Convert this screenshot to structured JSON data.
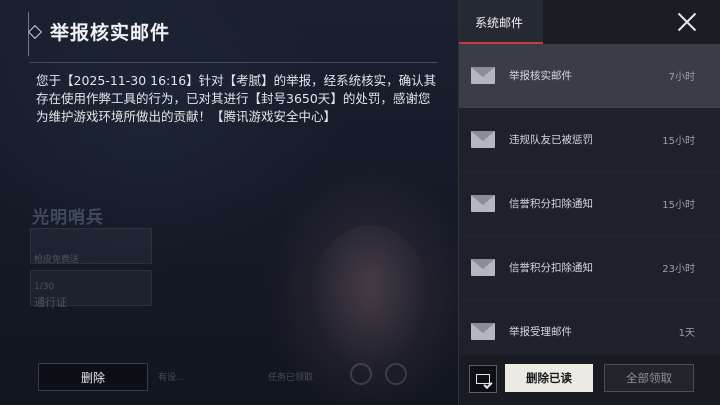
{
  "background": {
    "title_text": "光明哨兵",
    "card1_text": "枪皮免费送",
    "card2_text_a": "1/30",
    "card2_text_b": "通行证",
    "bottom_left_text": "有设...",
    "bottom_mid_text": "任务已领取"
  },
  "detail": {
    "title": "举报核实邮件",
    "body": "您于【2025-11-30 16:16】针对【考腻】的举报，经系统核实，确认其存在使用作弊工具的行为，已对其进行【封号3650天】的处罚，感谢您为维护游戏环境所做出的贡献！【腾讯游戏安全中心】",
    "delete_label": "删除"
  },
  "panel": {
    "tab_label": "系统邮件",
    "mails": [
      {
        "subject": "举报核实邮件",
        "time": "7小时",
        "active": true
      },
      {
        "subject": "违规队友已被惩罚",
        "time": "15小时",
        "active": false
      },
      {
        "subject": "信誉积分扣除通知",
        "time": "15小时",
        "active": false
      },
      {
        "subject": "信誉积分扣除通知",
        "time": "23小时",
        "active": false
      },
      {
        "subject": "举报受理邮件",
        "time": "1天",
        "active": false
      }
    ],
    "delete_read_label": "删除已读",
    "collect_all_label": "全部领取"
  },
  "colors": {
    "accent_red": "#c83a3e",
    "active_item_bg": "#3a3d45",
    "primary_button_bg": "#eceae3"
  },
  "icons": {
    "mail": "envelope-icon",
    "close": "close-icon",
    "mark_read": "envelope-check-icon",
    "title_marker": "diamond-icon"
  }
}
